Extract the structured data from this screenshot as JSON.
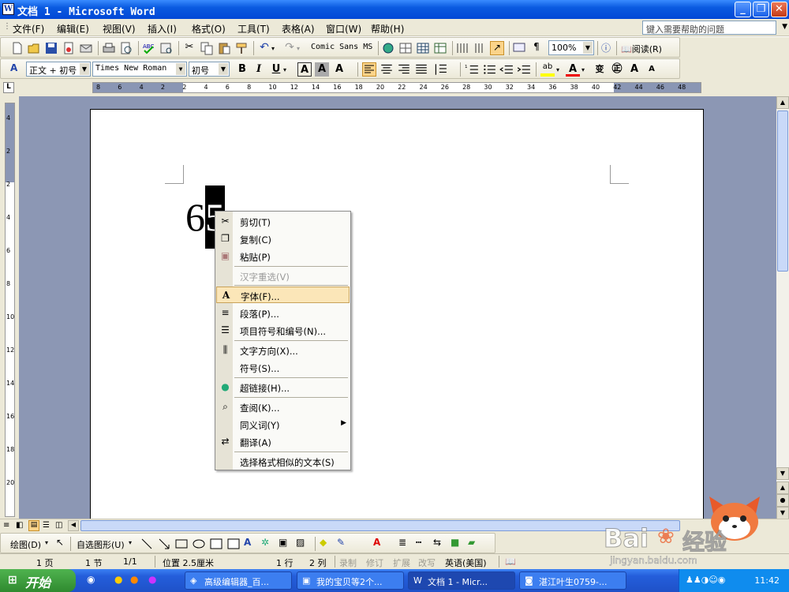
{
  "window": {
    "title": "文档 1 - Microsoft Word"
  },
  "menubar": {
    "items": [
      "文件(F)",
      "编辑(E)",
      "视图(V)",
      "插入(I)",
      "格式(O)",
      "工具(T)",
      "表格(A)",
      "窗口(W)",
      "帮助(H)"
    ],
    "help_placeholder": "键入需要帮助的问题"
  },
  "toolbar1": {
    "font_combo": "Comic Sans MS",
    "zoom": "100%",
    "read_label": "阅读(R)"
  },
  "toolbar2": {
    "style": "正文 + 初号",
    "font": "Times New Roman",
    "size": "初号",
    "bold": "B",
    "italic": "I",
    "underline": "U"
  },
  "ruler": {
    "ticks": [
      "8",
      "6",
      "4",
      "2",
      "2",
      "4",
      "6",
      "8",
      "10",
      "12",
      "14",
      "16",
      "18",
      "20",
      "22",
      "24",
      "26",
      "28",
      "30",
      "32",
      "34",
      "36",
      "38",
      "40",
      "42",
      "44",
      "46",
      "48"
    ]
  },
  "vruler": {
    "ticks": [
      "4",
      "2",
      "2",
      "4",
      "6",
      "8",
      "10",
      "12",
      "14",
      "16",
      "18",
      "20"
    ]
  },
  "document": {
    "text_before": "6",
    "selected_text": "5"
  },
  "context_menu": {
    "items": [
      {
        "label": "剪切(T)",
        "icon": "scissors-icon",
        "disabled": false
      },
      {
        "label": "复制(C)",
        "icon": "copy-icon",
        "disabled": false
      },
      {
        "label": "粘贴(P)",
        "icon": "paste-icon",
        "disabled": false
      },
      {
        "label": "汉字重选(V)",
        "icon": "",
        "disabled": true
      },
      {
        "label": "字体(F)...",
        "icon": "font-icon",
        "disabled": false,
        "highlighted": true
      },
      {
        "label": "段落(P)...",
        "icon": "paragraph-icon",
        "disabled": false
      },
      {
        "label": "项目符号和编号(N)...",
        "icon": "bullets-icon",
        "disabled": false
      },
      {
        "label": "文字方向(X)...",
        "icon": "text-direction-icon",
        "disabled": false
      },
      {
        "label": "符号(S)...",
        "icon": "",
        "disabled": false
      },
      {
        "label": "超链接(H)...",
        "icon": "hyperlink-icon",
        "disabled": false
      },
      {
        "label": "查阅(K)...",
        "icon": "lookup-icon",
        "disabled": false
      },
      {
        "label": "同义词(Y)",
        "icon": "",
        "disabled": false,
        "submenu": true
      },
      {
        "label": "翻译(A)",
        "icon": "translate-icon",
        "disabled": false
      },
      {
        "label": "选择格式相似的文本(S)",
        "icon": "",
        "disabled": false
      }
    ]
  },
  "drawbar": {
    "draw_label": "绘图(D)",
    "autoshape_label": "自选图形(U)"
  },
  "status": {
    "page": "1 页",
    "section": "1 节",
    "pages": "1/1",
    "position": "位置 2.5厘米",
    "line": "1 行",
    "col": "2 列",
    "rec": "录制",
    "trk": "修订",
    "ext": "扩展",
    "ovr": "改写",
    "lang": "英语(美国)"
  },
  "taskbar": {
    "start": "开始",
    "tasks": [
      "高级编辑器_百...",
      "我的宝贝等2个...",
      "文档 1 - Micr...",
      "湛江叶生0759-..."
    ],
    "clock": "11:42"
  },
  "watermark": {
    "brand": "Bai",
    "brand2": "经验",
    "url": "jingyan.baidu.com"
  },
  "colors": {
    "titlebar": "#0a5ae0",
    "taskbar": "#245edb",
    "start": "#2f8a2f",
    "highlight": "#fbe6b8",
    "doc_bg": "#8c97b4"
  }
}
